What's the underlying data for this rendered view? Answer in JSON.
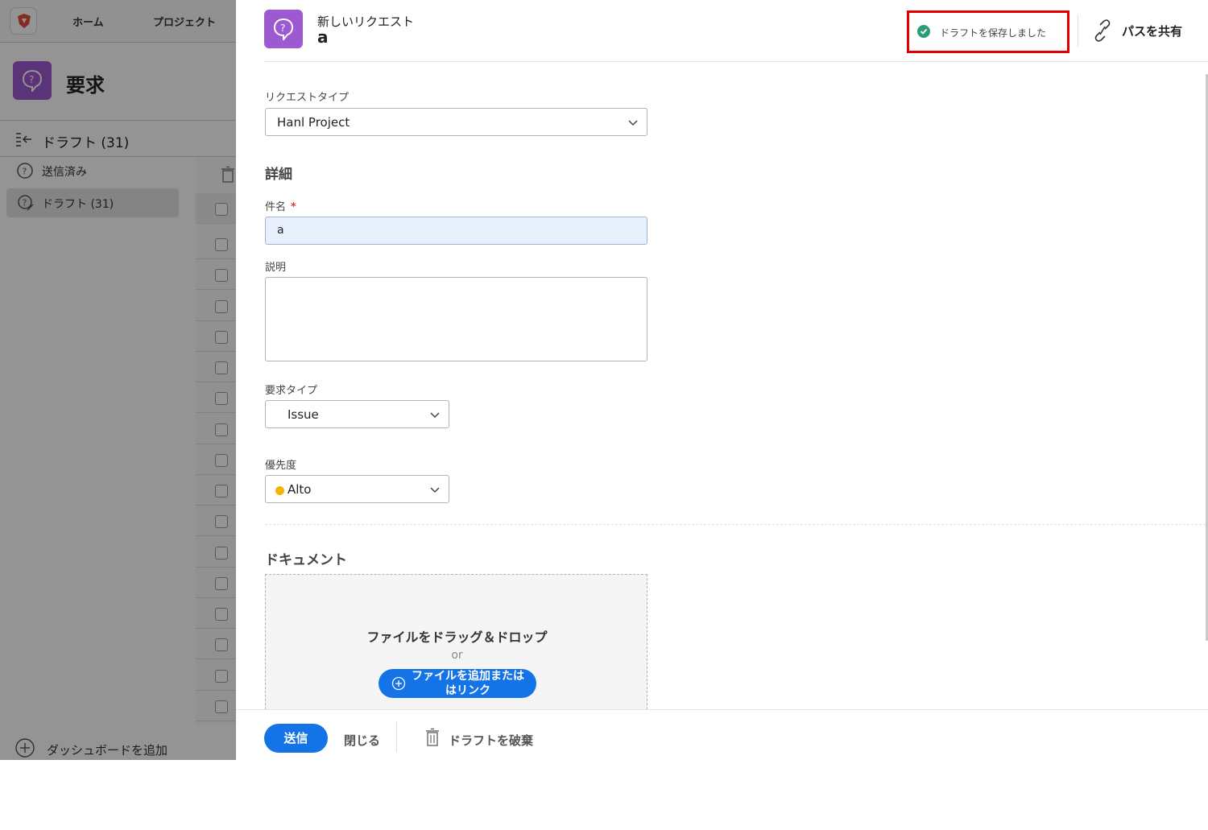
{
  "nav": {
    "home": "ホーム",
    "projects": "プロジェクト"
  },
  "sidebar": {
    "title": "要求",
    "drafts_header": "ドラフト (31)",
    "items": [
      {
        "label": "送信済み"
      },
      {
        "label": "ドラフト (31)"
      }
    ],
    "add_dashboard": "ダッシュボードを追加"
  },
  "panel": {
    "subtitle": "新しいリクエスト",
    "title": "a",
    "status": "ドラフトを保存しました",
    "share": "パスを共有"
  },
  "form": {
    "request_type_label": "リクエストタイプ",
    "request_type_value": "Hanl Project",
    "details_title": "詳細",
    "subject_label": "件名",
    "subject_required": "*",
    "subject_value": "a",
    "description_label": "説明",
    "description_value": "",
    "req_kind_label": "要求タイプ",
    "req_kind_value": "Issue",
    "priority_label": "優先度",
    "priority_value": "Alto",
    "priority_color": "#f4b400"
  },
  "documents": {
    "title": "ドキュメント",
    "drop_text": "ファイルをドラッグ＆ドロップ",
    "or": "or",
    "add_button": "ファイルを追加または\nはリンク"
  },
  "footer": {
    "send": "送信",
    "close": "閉じる",
    "discard": "ドラフトを破棄"
  },
  "colors": {
    "accent": "#1473e6",
    "request_icon": "#9c59d1",
    "saved_ok": "#2d9d78",
    "highlight_box": "#e00000"
  }
}
